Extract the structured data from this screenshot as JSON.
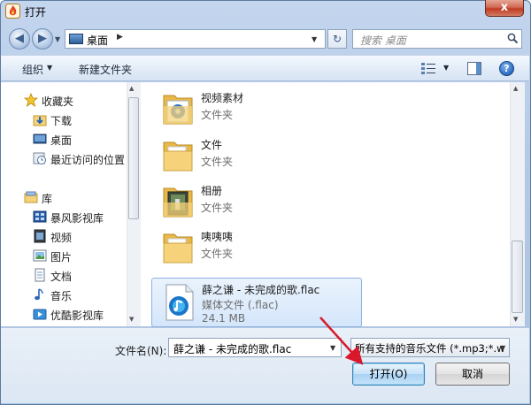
{
  "window": {
    "title": "打开",
    "close_glyph": "x",
    "icon": "app-flame-icon"
  },
  "address": {
    "location": "桌面",
    "search_placeholder": "搜索 桌面"
  },
  "toolbar": {
    "organize_label": "组织",
    "new_folder_label": "新建文件夹",
    "help_glyph": "?"
  },
  "nav": {
    "items": [
      {
        "label": "收藏夹",
        "icon": "star-icon"
      },
      {
        "label": "下载",
        "icon": "download-folder-icon"
      },
      {
        "label": "桌面",
        "icon": "desktop-icon"
      },
      {
        "label": "最近访问的位置",
        "icon": "recent-places-icon"
      },
      {
        "label": "库",
        "icon": "library-icon"
      },
      {
        "label": "暴风影视库",
        "icon": "video-library-icon"
      },
      {
        "label": "视频",
        "icon": "video-icon"
      },
      {
        "label": "图片",
        "icon": "picture-icon"
      },
      {
        "label": "文档",
        "icon": "document-icon"
      },
      {
        "label": "音乐",
        "icon": "music-icon"
      },
      {
        "label": "优酷影视库",
        "icon": "youku-library-icon"
      }
    ]
  },
  "files": [
    {
      "name": "视频素材",
      "type": "文件夹",
      "icon": "media-folder-icon"
    },
    {
      "name": "文件",
      "type": "文件夹",
      "icon": "folder-icon"
    },
    {
      "name": "相册",
      "type": "文件夹",
      "icon": "photo-folder-icon"
    },
    {
      "name": "咦咦咦",
      "type": "文件夹",
      "icon": "folder-icon"
    },
    {
      "name": "薛之谦 - 未完成的歌.flac",
      "type": "媒体文件 (.flac)",
      "size": "24.1 MB",
      "icon": "flac-audio-file-icon",
      "selected": true
    }
  ],
  "bottom": {
    "filename_label": "文件名(N):",
    "filename_value": "薛之谦 - 未完成的歌.flac",
    "filetype_value": "所有支持的音乐文件 (*.mp3;*.w",
    "open_button": "打开(O)",
    "cancel_button": "取消"
  },
  "colors": {
    "frame": "#b3c9e6",
    "selection": "#d5e6fb",
    "annotation_arrow": "#d9192b"
  }
}
